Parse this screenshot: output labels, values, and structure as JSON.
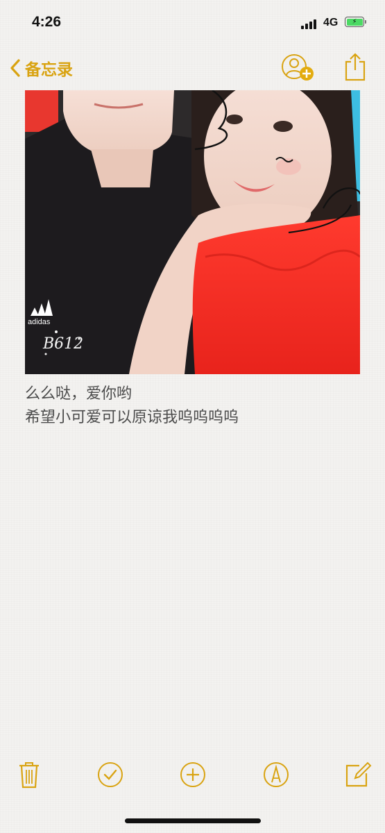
{
  "status_bar": {
    "time": "4:26",
    "network": "4G",
    "battery_charging": true
  },
  "nav": {
    "back_label": "备忘录",
    "accent_color": "#d9a311"
  },
  "note": {
    "photo_watermark": "B612",
    "photo_shirt_logo": "adidas",
    "lines": [
      "么么哒，爱你哟",
      "希望小可爱可以原谅我呜呜呜呜"
    ]
  },
  "toolbar": {
    "icons": [
      "trash-icon",
      "checklist-icon",
      "add-icon",
      "markup-icon",
      "compose-icon"
    ]
  }
}
